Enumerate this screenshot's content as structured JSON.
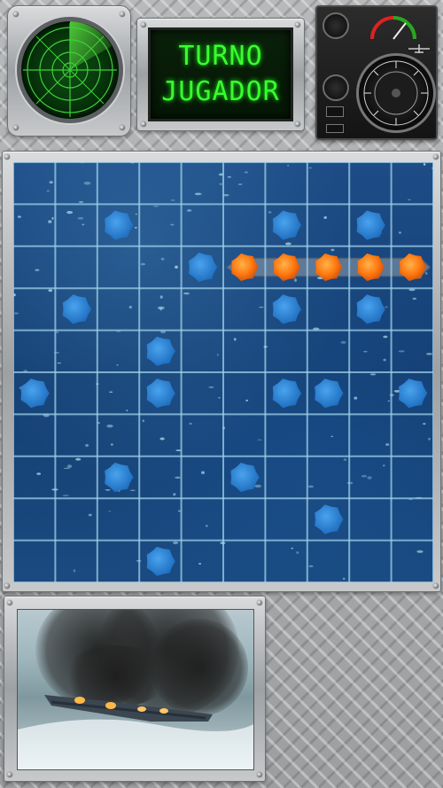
{
  "turn_display": {
    "line1": "TURNO",
    "line2": "JUGADOR"
  },
  "board": {
    "rows": 10,
    "cols": 10,
    "misses": [
      [
        1,
        2
      ],
      [
        1,
        6
      ],
      [
        1,
        8
      ],
      [
        2,
        4
      ],
      [
        3,
        1
      ],
      [
        3,
        6
      ],
      [
        3,
        8
      ],
      [
        4,
        3
      ],
      [
        5,
        0
      ],
      [
        5,
        3
      ],
      [
        5,
        6
      ],
      [
        5,
        7
      ],
      [
        5,
        9
      ],
      [
        7,
        2
      ],
      [
        7,
        5
      ],
      [
        8,
        7
      ],
      [
        9,
        3
      ]
    ],
    "hits": [
      [
        2,
        5
      ],
      [
        2,
        6
      ],
      [
        2,
        7
      ],
      [
        2,
        8
      ],
      [
        2,
        9
      ]
    ],
    "colors": {
      "miss": "#2f86d6",
      "hit": "#ff7a10",
      "grid": "#9fd0e8",
      "water": "#19467c"
    }
  },
  "icons": {
    "radar": "radar-scope-icon",
    "instruments": "instrument-panel-icon",
    "video": "burning-ship-video"
  }
}
